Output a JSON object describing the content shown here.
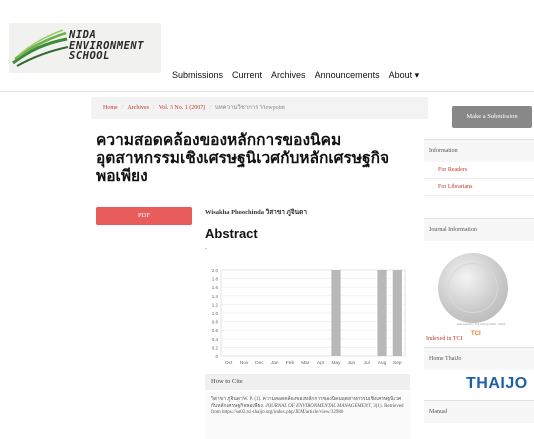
{
  "logo": {
    "text": "NIDA\nENVIRONMENT\nSCHOOL"
  },
  "nav": {
    "items": [
      "Submissions",
      "Current",
      "Archives",
      "Announcements",
      "About ▾"
    ]
  },
  "breadcrumb": {
    "home": "Home",
    "archives": "Archives",
    "issue": "Vol. 3 No. 1 (2007)",
    "current": "บทความวิชาการ Viewpoint"
  },
  "article": {
    "title": "ความสอดคล้องของหลักการของนิคมอุตสาหกรรมเชิงเศรษฐนิเวศกับหลักเศรษฐกิจพอเพียง",
    "authors": "Wisakha Phoochinda วิสาขา ภู่จินดา",
    "pdf_label": "PDF",
    "abstract_heading": "Abstract",
    "abstract_text": "-"
  },
  "cite": {
    "heading": "How to Cite",
    "text_plain": "วิสาขา ภู่จินดาW. P. (1). ความสอดคล้องของหลักการของนิคมอุตสาหกรรมเชิงเศรษฐนิเวศกับหลักเศรษฐกิจพอเพียง. ",
    "journal": "JOURNAL OF ENVIRONMENTAL MANAGEMENT",
    "text_tail": ", 3(1). Retrieved from https://so02.tci-thaijo.org/index.php/JEM/article/view/32980"
  },
  "sidebar": {
    "submit_label": "Make a Submission",
    "information_heading": "Information",
    "links": [
      "For Readers",
      "For Librarians"
    ],
    "journal_info_heading": "Journal Information",
    "badge_caption": "Approved by TCI during 2020 - 2024",
    "tci_text": "Indexed in TCI",
    "tci_logo": "TCI",
    "home_thaijo_heading": "Home ThaiJo",
    "thaijo_logo": "THAIJO",
    "manual_heading": "Manual"
  },
  "chart_data": {
    "type": "bar",
    "categories": [
      "Oct",
      "Nov",
      "Dec",
      "Jan",
      "Feb",
      "Mar",
      "Apr",
      "May",
      "Jun",
      "Jul",
      "Aug",
      "Sep"
    ],
    "values": [
      0,
      0,
      0,
      0,
      0,
      0,
      0,
      2,
      0,
      0,
      2,
      2
    ],
    "yticks": [
      "2.0",
      "1.8",
      "1.6",
      "1.4",
      "1.2",
      "1.0",
      "0.8",
      "0.6",
      "0.4",
      "0.2",
      "0"
    ],
    "ylim": [
      0,
      2
    ],
    "grid": true,
    "bar_color": "#b8b8b8"
  }
}
